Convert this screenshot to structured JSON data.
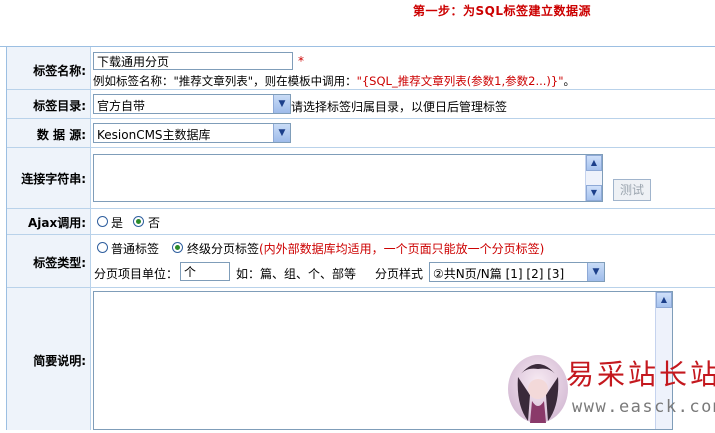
{
  "header": {
    "title": "第一步：为SQL标签建立数据源"
  },
  "rows": {
    "name": {
      "label": "标签名称:",
      "value": "下载通用分页",
      "required_mark": "*",
      "hint_prefix": "例如标签名称：\"推荐文章列表\"，则在模板中调用：",
      "hint_code": "\"{SQL_推荐文章列表(参数1,参数2...)}\"",
      "hint_suffix": "。"
    },
    "catalog": {
      "label": "标签目录:",
      "selected": "官方自带",
      "hint": "请选择标签归属目录，以便日后管理标签"
    },
    "datasource": {
      "label": "数 据 源:",
      "selected": "KesionCMS主数据库"
    },
    "connection": {
      "label": "连接字符串:",
      "value": "",
      "test_button": "测试"
    },
    "ajax": {
      "label": "Ajax调用:",
      "options": [
        "是",
        "否"
      ],
      "selected": "否"
    },
    "tagtype": {
      "label": "标签类型:",
      "options": [
        "普通标签",
        "终级分页标签"
      ],
      "selected": "终级分页标签",
      "note": "(内外部数据库均适用，一个页面只能放一个分页标签)",
      "unit_label": "分页项目单位：",
      "unit_value": "个",
      "unit_example": "如：篇、组、个、部等",
      "style_label": "分页样式",
      "style_selected": "②共N页/N篇 [1] [2] [3]"
    },
    "description": {
      "label": "简要说明:",
      "value": ""
    }
  },
  "watermark": {
    "text": "易采站长站",
    "url": "www.easck.com"
  },
  "colors": {
    "accent": "#cc0000",
    "label_bg": "#eef3fa",
    "border": "#b9d2ea"
  }
}
